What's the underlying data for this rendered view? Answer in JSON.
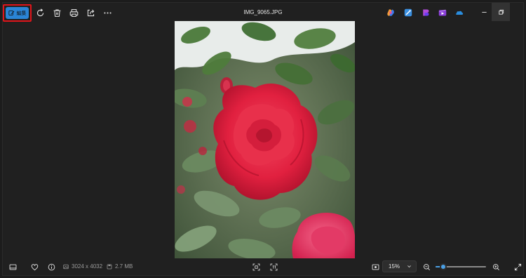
{
  "toolbar": {
    "edit_label": "編集",
    "icons": [
      "edit-icon",
      "rotate-icon",
      "delete-icon",
      "print-icon",
      "share-icon",
      "more-icon"
    ]
  },
  "window": {
    "title": "IMG_9065.JPG",
    "apps": [
      "copilot-icon",
      "clipchamp-icon",
      "designer-icon",
      "video-editor-icon",
      "onedrive-icon"
    ],
    "controls": [
      "minimize-icon",
      "restore-icon"
    ]
  },
  "statusbar": {
    "dimensions": "3024 x 4032",
    "file_size": "2.7 MB",
    "zoom_percent": "15%",
    "zoom_level": 0.15
  },
  "colors": {
    "accent": "#2a85d6",
    "highlight_border": "#e0151b",
    "background": "#202020"
  }
}
